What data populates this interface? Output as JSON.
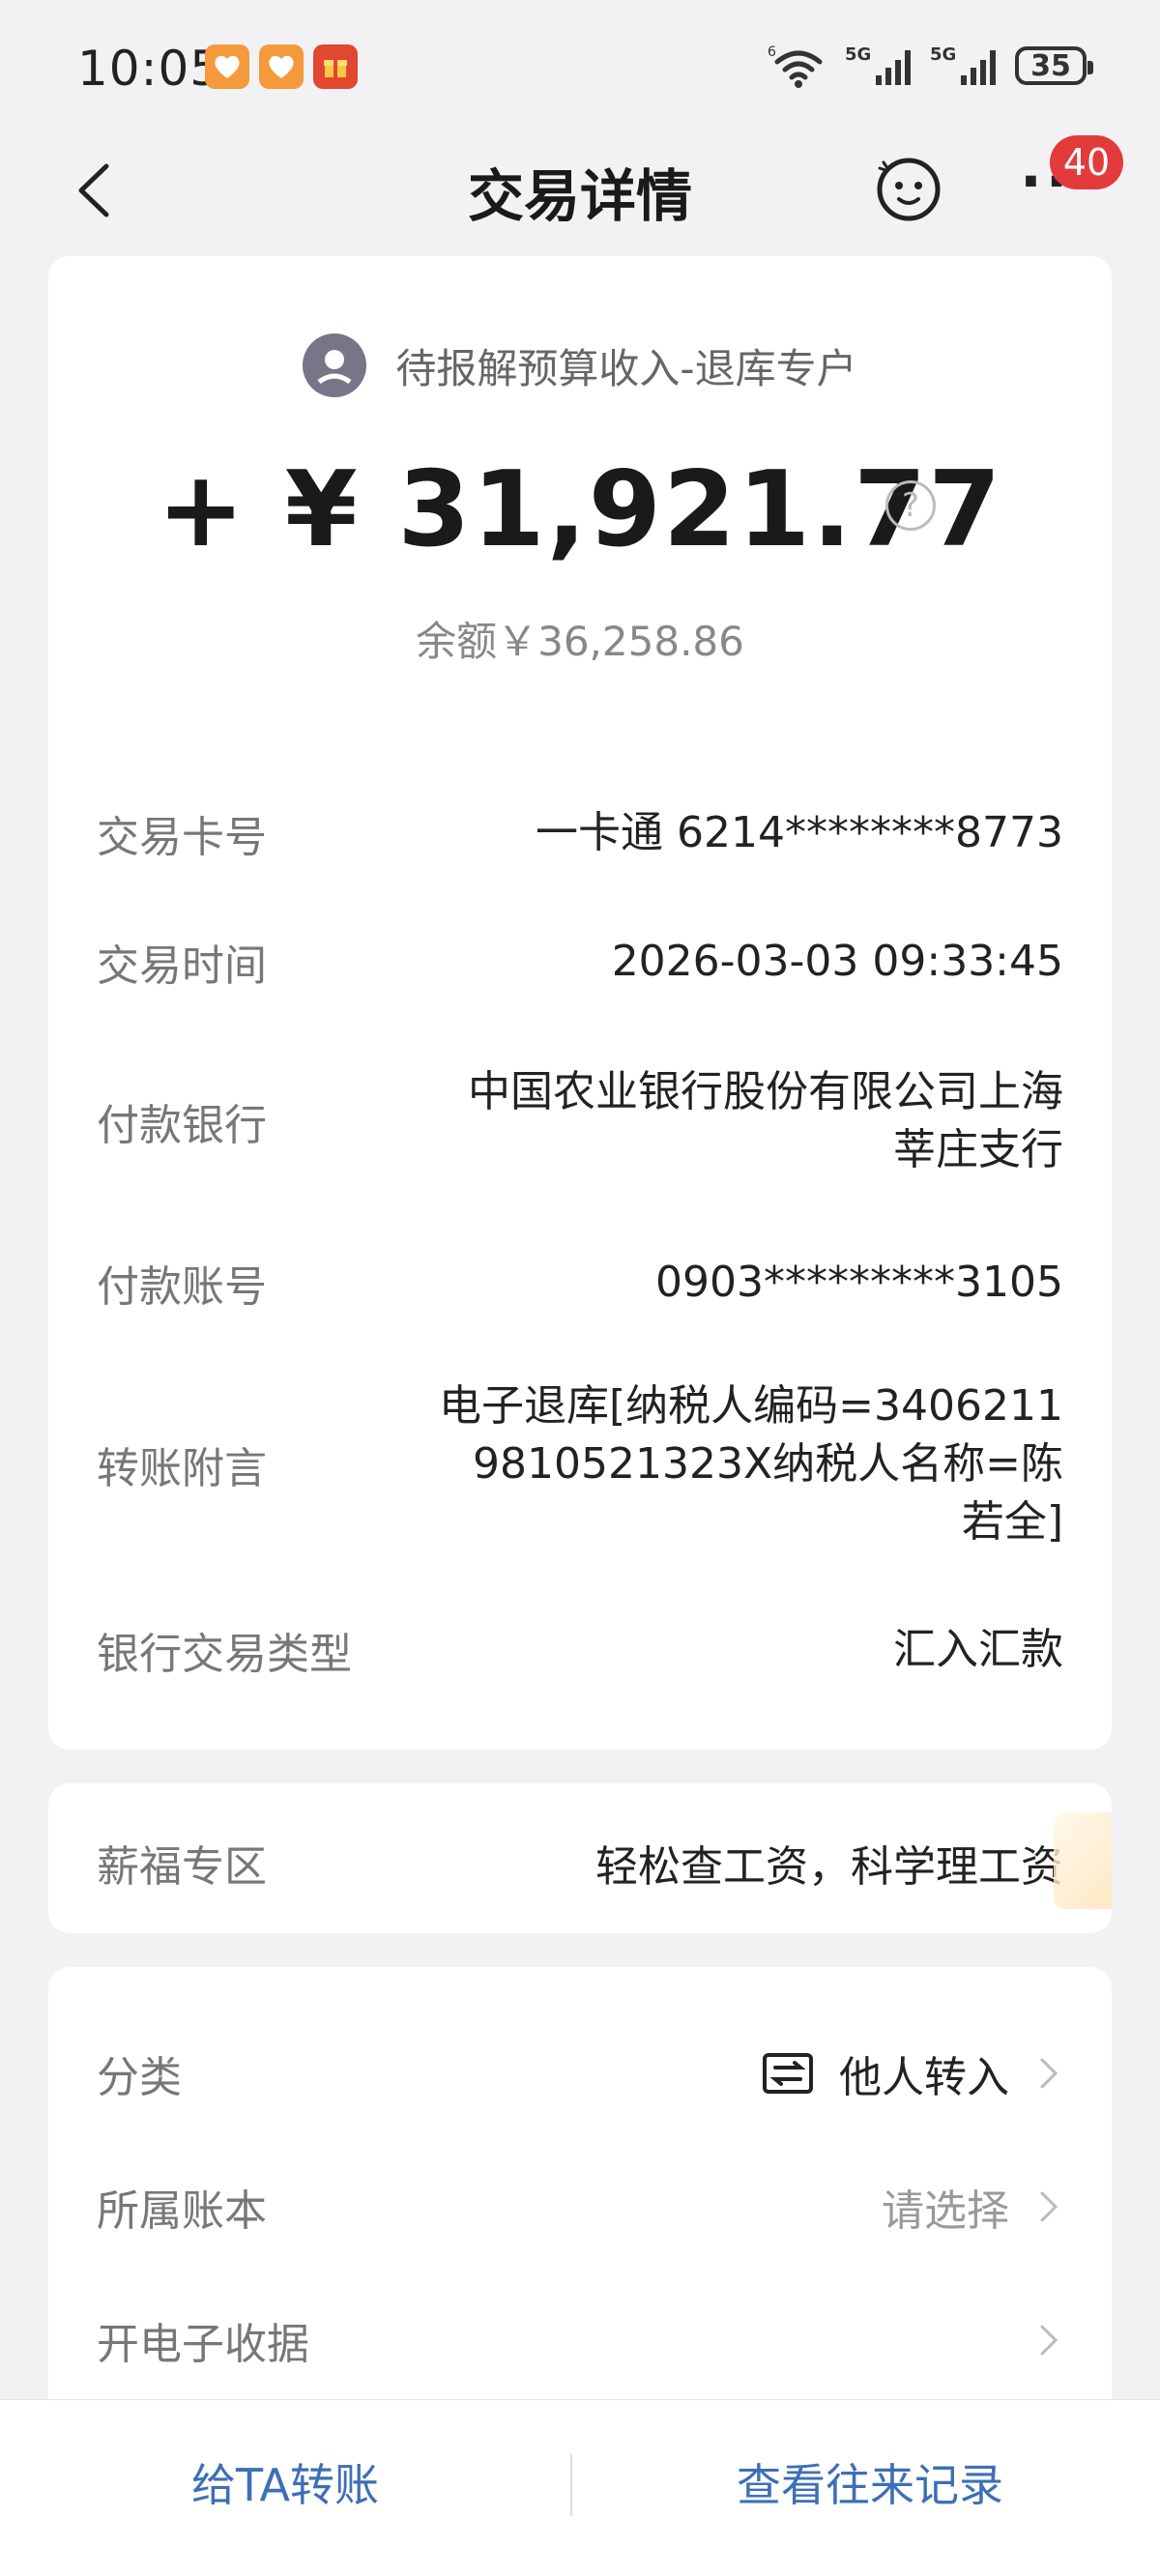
{
  "status_bar": {
    "time": "10:05",
    "battery": "35",
    "network_1": "6",
    "network_2": "5G",
    "network_3": "5G"
  },
  "nav": {
    "title": "交易详情",
    "badge_count": "40"
  },
  "transaction": {
    "payee": "待报解预算收入-退库专户",
    "amount": "+ ¥ 31,921.77",
    "balance": "余额￥36,258.86",
    "help_symbol": "?"
  },
  "details": [
    {
      "label": "交易卡号",
      "value": "一卡通 6214********8773"
    },
    {
      "label": "交易时间",
      "value": "2026-03-03 09:33:45"
    },
    {
      "label": "付款银行",
      "value": "中国农业银行股份有限公司上海莘庄支行"
    },
    {
      "label": "付款账号",
      "value": "0903*********3105"
    },
    {
      "label": "转账附言",
      "value": "电子退库[纳税人编码=34062119810521323X纳税人名称=陈若全]"
    },
    {
      "label": "银行交易类型",
      "value": "汇入汇款"
    }
  ],
  "salary_zone": {
    "label": "薪福专区",
    "value": "轻松查工资，科学理工资"
  },
  "options": [
    {
      "label": "分类",
      "value": "他人转入"
    },
    {
      "label": "所属账本",
      "value": "请选择"
    },
    {
      "label": "开电子收据",
      "value": ""
    }
  ],
  "bottom": {
    "transfer": "给TA转账",
    "history": "查看往来记录"
  },
  "colors": {
    "accent_blue": "#3d6fb6",
    "badge_red": "#e33b3b",
    "background": "#f2f2f4"
  }
}
